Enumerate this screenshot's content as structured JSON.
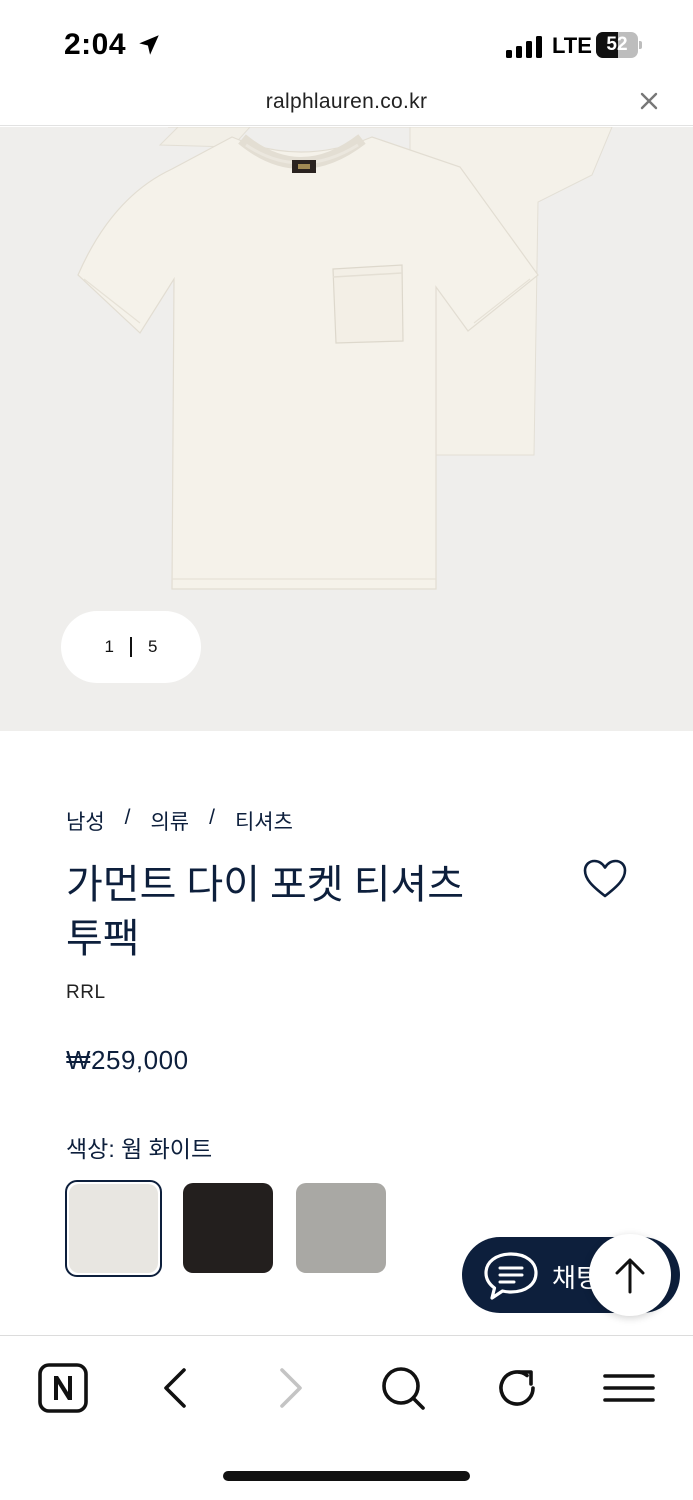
{
  "status_bar": {
    "time": "2:04",
    "network": "LTE",
    "battery_level": "52",
    "battery_fraction": 0.52
  },
  "url_bar": {
    "url": "ralphlauren.co.kr",
    "close_icon": "close-icon"
  },
  "gallery": {
    "current": "1",
    "total": "5"
  },
  "breadcrumb": {
    "items": [
      "남성",
      "의류",
      "티셔츠"
    ],
    "separator": "/"
  },
  "product": {
    "title_line1": "가먼트 다이 포켓 티셔츠",
    "title_line2": "투팩",
    "brand": "RRL",
    "price": "₩259,000",
    "color_label": "색상: 웜 화이트"
  },
  "swatches": [
    {
      "name": "warm-white",
      "color": "#e8e6e1",
      "selected": true
    },
    {
      "name": "black",
      "color": "#231f1e",
      "selected": false
    },
    {
      "name": "grey",
      "color": "#a9a8a4",
      "selected": false
    }
  ],
  "chat": {
    "label": "채팅하기"
  },
  "colors": {
    "navy": "#0d1f3c",
    "hero_bg": "#efeeec"
  },
  "toolbar": {
    "icons": [
      "naver-n-icon",
      "back-icon",
      "forward-icon",
      "search-icon",
      "refresh-icon",
      "menu-icon"
    ]
  }
}
